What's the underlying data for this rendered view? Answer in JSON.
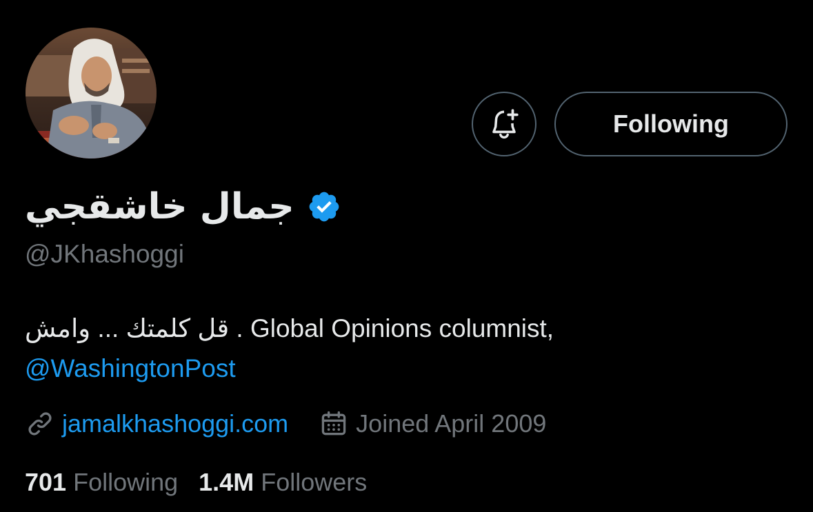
{
  "profile": {
    "display_name": "جمال خاشقجي",
    "verified": true,
    "handle": "@JKhashoggi",
    "bio_text": "قل كلمتك ... وامش . Global Opinions columnist,",
    "bio_link": "@WashingtonPost",
    "website": "jamalkhashoggi.com",
    "joined": "Joined April 2009",
    "avatar_description": "profile photo"
  },
  "actions": {
    "notify_icon": "bell-plus-icon",
    "following_label": "Following"
  },
  "stats": {
    "following_count": "701",
    "following_label": "Following",
    "followers_count": "1.4M",
    "followers_label": "Followers"
  },
  "icons": {
    "verified": "verified-badge-icon",
    "link": "link-icon",
    "calendar": "calendar-icon"
  },
  "colors": {
    "background": "#000000",
    "primary_text": "#e7e9ea",
    "secondary_text": "#71767b",
    "link": "#1d9bf0",
    "button_border": "#536471"
  }
}
